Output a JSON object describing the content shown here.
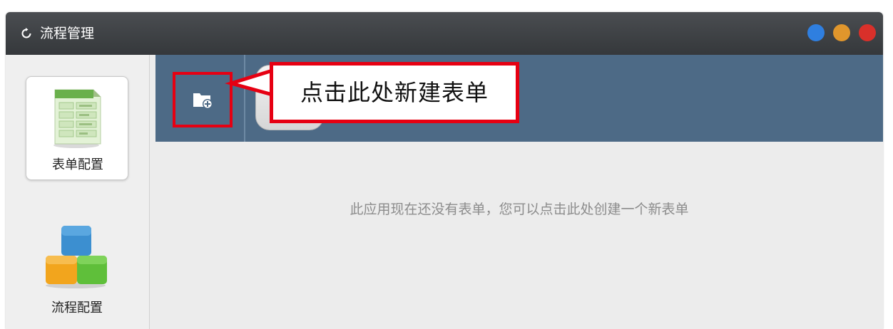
{
  "window": {
    "title": "流程管理",
    "title_icon": "refresh-icon",
    "controls": [
      "minimize-button",
      "maximize-button",
      "close-button"
    ],
    "control_colors": {
      "minimize": "#2f7fe0",
      "maximize": "#e0962c",
      "close": "#d9302a"
    }
  },
  "sidebar": {
    "items": [
      {
        "label": "表单配置",
        "icon": "form-sheet-icon",
        "active": true
      },
      {
        "label": "流程配置",
        "icon": "blocks-icon",
        "active": false
      }
    ]
  },
  "toolbar": {
    "background": "#4d6a86",
    "new_form_icon": "folder-add-icon",
    "callout": "点击此处新建表单",
    "callout_color": "#e60012"
  },
  "main": {
    "empty_message": "此应用现在还没有表单，您可以点击此处创建一个新表单"
  }
}
